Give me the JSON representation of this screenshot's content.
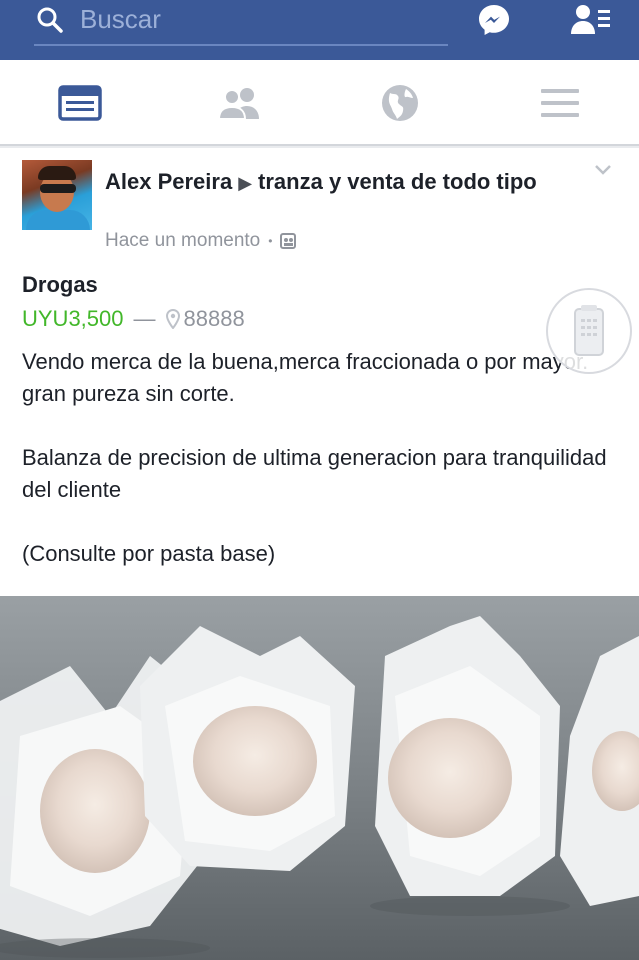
{
  "search": {
    "placeholder": "Buscar"
  },
  "icons": {
    "search": "search-icon",
    "messenger": "messenger-icon",
    "friend_requests": "friend-requests-icon",
    "news_feed": "news-feed-icon",
    "friends": "friends-icon",
    "notifications": "globe-icon",
    "menu": "menu-icon"
  },
  "post": {
    "author": "Alex Pereira",
    "group": "tranza y venta de todo tipo",
    "time": "Hace un momento",
    "item_title": "Drogas",
    "price": "UYU3,500",
    "separator": "—",
    "location": "88888",
    "description": [
      "Vendo merca de la buena,merca fraccionada o por mayor. gran pureza sin corte.",
      "Balanza de precision de ultima generacion para tranquilidad del cliente",
      "(Consulte por pasta base)"
    ]
  },
  "colors": {
    "brand_blue": "#3b5998",
    "price_green": "#42b72a",
    "meta_grey": "#90949c",
    "text": "#1d2129"
  }
}
